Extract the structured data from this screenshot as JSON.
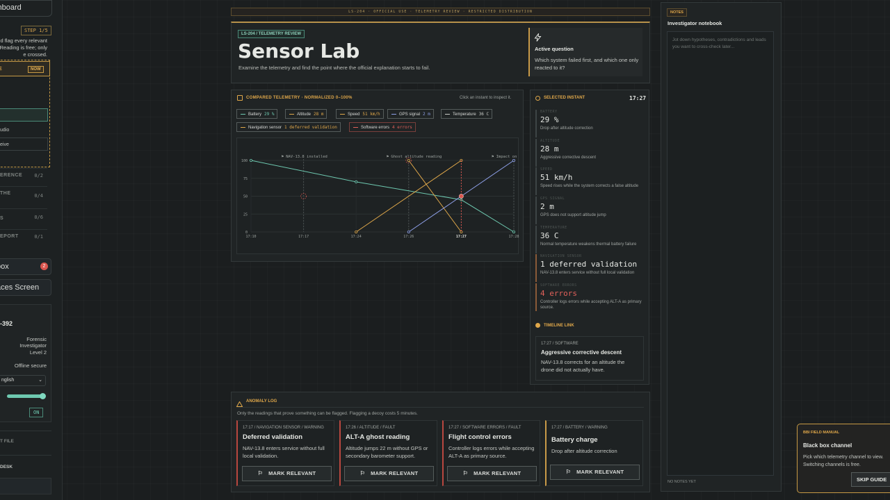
{
  "sidebar": {
    "dashboard_label": "shboard",
    "step": "STEP 1/5",
    "intro_lines": [
      "d flag every relevant",
      "Reading is free; only",
      "e crossed."
    ],
    "now_letter": "E",
    "now_badge": "NOW",
    "rows": [
      "udio",
      "eive"
    ],
    "nav": [
      {
        "label": "ERENCE",
        "count": "0/2"
      },
      {
        "label": "THE",
        "count": "0/4"
      },
      {
        "label": "S",
        "count": "0/6"
      },
      {
        "label": "EPORT",
        "count": "0/1"
      }
    ],
    "inbox_label": "box",
    "inbox_count": "2",
    "faces_label": "aces Screen",
    "profile": {
      "id": "-392",
      "role": "Forensic Investigator",
      "level": "Level 2",
      "status": "Offline secure",
      "language": "nglish",
      "toggle": "ON"
    },
    "footer_items": [
      "T FILE",
      "DESK"
    ]
  },
  "topbar": "LS-204 · OFFICIAL USE · TELEMETRY REVIEW · RESTRICTED DISTRIBUTION",
  "hero": {
    "tag": "LS-204 / TELEMETRY REVIEW",
    "title": "Sensor Lab",
    "subtitle": "Examine the telemetry and find the point where the official explanation starts to fail."
  },
  "active_question": {
    "title": "Active question",
    "text": "Which system failed first, and which one only reacted to it?"
  },
  "telemetry": {
    "header": "COMPARED TELEMETRY · NORMALIZED 0–100%",
    "hint": "Click an instant to inspect it.",
    "chips": [
      {
        "label": "Battery",
        "value": "29 %",
        "color": "#6ec9b0"
      },
      {
        "label": "Altitude",
        "value": "28 m",
        "color": "#e0a84a"
      },
      {
        "label": "Speed",
        "value": "51 km/h",
        "color": "#e0a84a"
      },
      {
        "label": "GPS signal",
        "value": "2 m",
        "color": "#8ea0e8"
      },
      {
        "label": "Temperature",
        "value": "36 C",
        "color": "#c9ccc8"
      },
      {
        "label": "Navigation sensor",
        "value": "1 deferred validation",
        "color": "#e0a84a"
      },
      {
        "label": "Software errors",
        "value": "4 errors",
        "color": "#e0605a"
      }
    ]
  },
  "chart_data": {
    "type": "line",
    "x": [
      "17:10",
      "17:17",
      "17:24",
      "17:26",
      "17:27",
      "17:28"
    ],
    "ylim": [
      0,
      100
    ],
    "yticks": [
      0,
      25,
      50,
      75,
      100
    ],
    "events": [
      {
        "x": "17:17",
        "label": "NAV-13.8 installed"
      },
      {
        "x": "17:26",
        "label": "Ghost altitude reading"
      },
      {
        "x": "17:28",
        "label": "Impact on ro"
      }
    ],
    "selected_x": "17:27",
    "series": [
      {
        "name": "Battery",
        "color": "#6ec9b0",
        "values": [
          100,
          null,
          70,
          null,
          45,
          0
        ]
      },
      {
        "name": "Altitude",
        "color": "#e0a84a",
        "values": [
          null,
          null,
          null,
          100,
          0,
          null
        ]
      },
      {
        "name": "Speed",
        "color": "#e0a84a",
        "values": [
          null,
          null,
          0,
          null,
          100,
          null
        ]
      },
      {
        "name": "GPS signal",
        "color": "#8ea0e8",
        "values": [
          null,
          null,
          null,
          0,
          50,
          100
        ]
      }
    ]
  },
  "instant": {
    "header": "SELECTED INSTANT",
    "time": "17:27",
    "metrics": [
      {
        "label": "BATTERY",
        "value": "29 %",
        "note": "Drop after altitude correction",
        "kind": "normal"
      },
      {
        "label": "ALTITUDE",
        "value": "28 m",
        "note": "Aggressive corrective descent",
        "kind": "normal"
      },
      {
        "label": "SPEED",
        "value": "51 km/h",
        "note": "Speed rises while the system corrects a false altitude",
        "kind": "normal"
      },
      {
        "label": "GPS SIGNAL",
        "value": "2 m",
        "note": "GPS does not support altitude jump",
        "kind": "normal"
      },
      {
        "label": "TEMPERATURE",
        "value": "36 C",
        "note": "Normal temperature weakens thermal battery failure",
        "kind": "normal"
      },
      {
        "label": "NAVIGATION SENSOR",
        "value": "1 deferred validation",
        "note": "NAV-13.8 enters service without full local validation",
        "kind": "warn"
      },
      {
        "label": "SOFTWARE ERRORS",
        "value": "4 errors",
        "note": "Controller logs errors while accepting ALT-A as primary source.",
        "kind": "err"
      }
    ],
    "timeline_header": "TIMELINE LINK",
    "timeline": {
      "meta": "17:27 / SOFTWARE",
      "title": "Aggressive corrective descent",
      "text": "NAV-13.8 corrects for an altitude the drone did not actually have."
    }
  },
  "notes": {
    "tag": "NOTES",
    "title": "Investigator notebook",
    "placeholder": "Jot down hypotheses, contradictions and leads you want to cross-check later...",
    "footer": "NO NOTES YET"
  },
  "anomaly": {
    "header": "ANOMALY LOG",
    "subtitle": "Only the readings that prove something can be flagged. Flagging a decoy costs 5 minutes.",
    "button_label": "MARK RELEVANT",
    "cards": [
      {
        "meta": "17:17 / NAVIGATION SENSOR / WARNING",
        "title": "Deferred validation",
        "text": "NAV-13.8 enters service without full local validation."
      },
      {
        "meta": "17:26 / ALTITUDE / FAULT",
        "title": "ALT-A ghost reading",
        "text": "Altitude jumps 22 m without GPS or secondary barometer support."
      },
      {
        "meta": "17:27 / SOFTWARE ERRORS / FAULT",
        "title": "Flight control errors",
        "text": "Controller logs errors while accepting ALT-A as primary source."
      },
      {
        "meta": "17:27 / BATTERY / WARNING",
        "title": "Battery charge",
        "text": "Drop after altitude correction"
      }
    ]
  },
  "manual": {
    "tag": "BBI FIELD MANUAL",
    "title": "Black box channel",
    "text": "Pick which telemetry channel to view. Switching channels is free.",
    "button": "SKIP GUIDE"
  }
}
